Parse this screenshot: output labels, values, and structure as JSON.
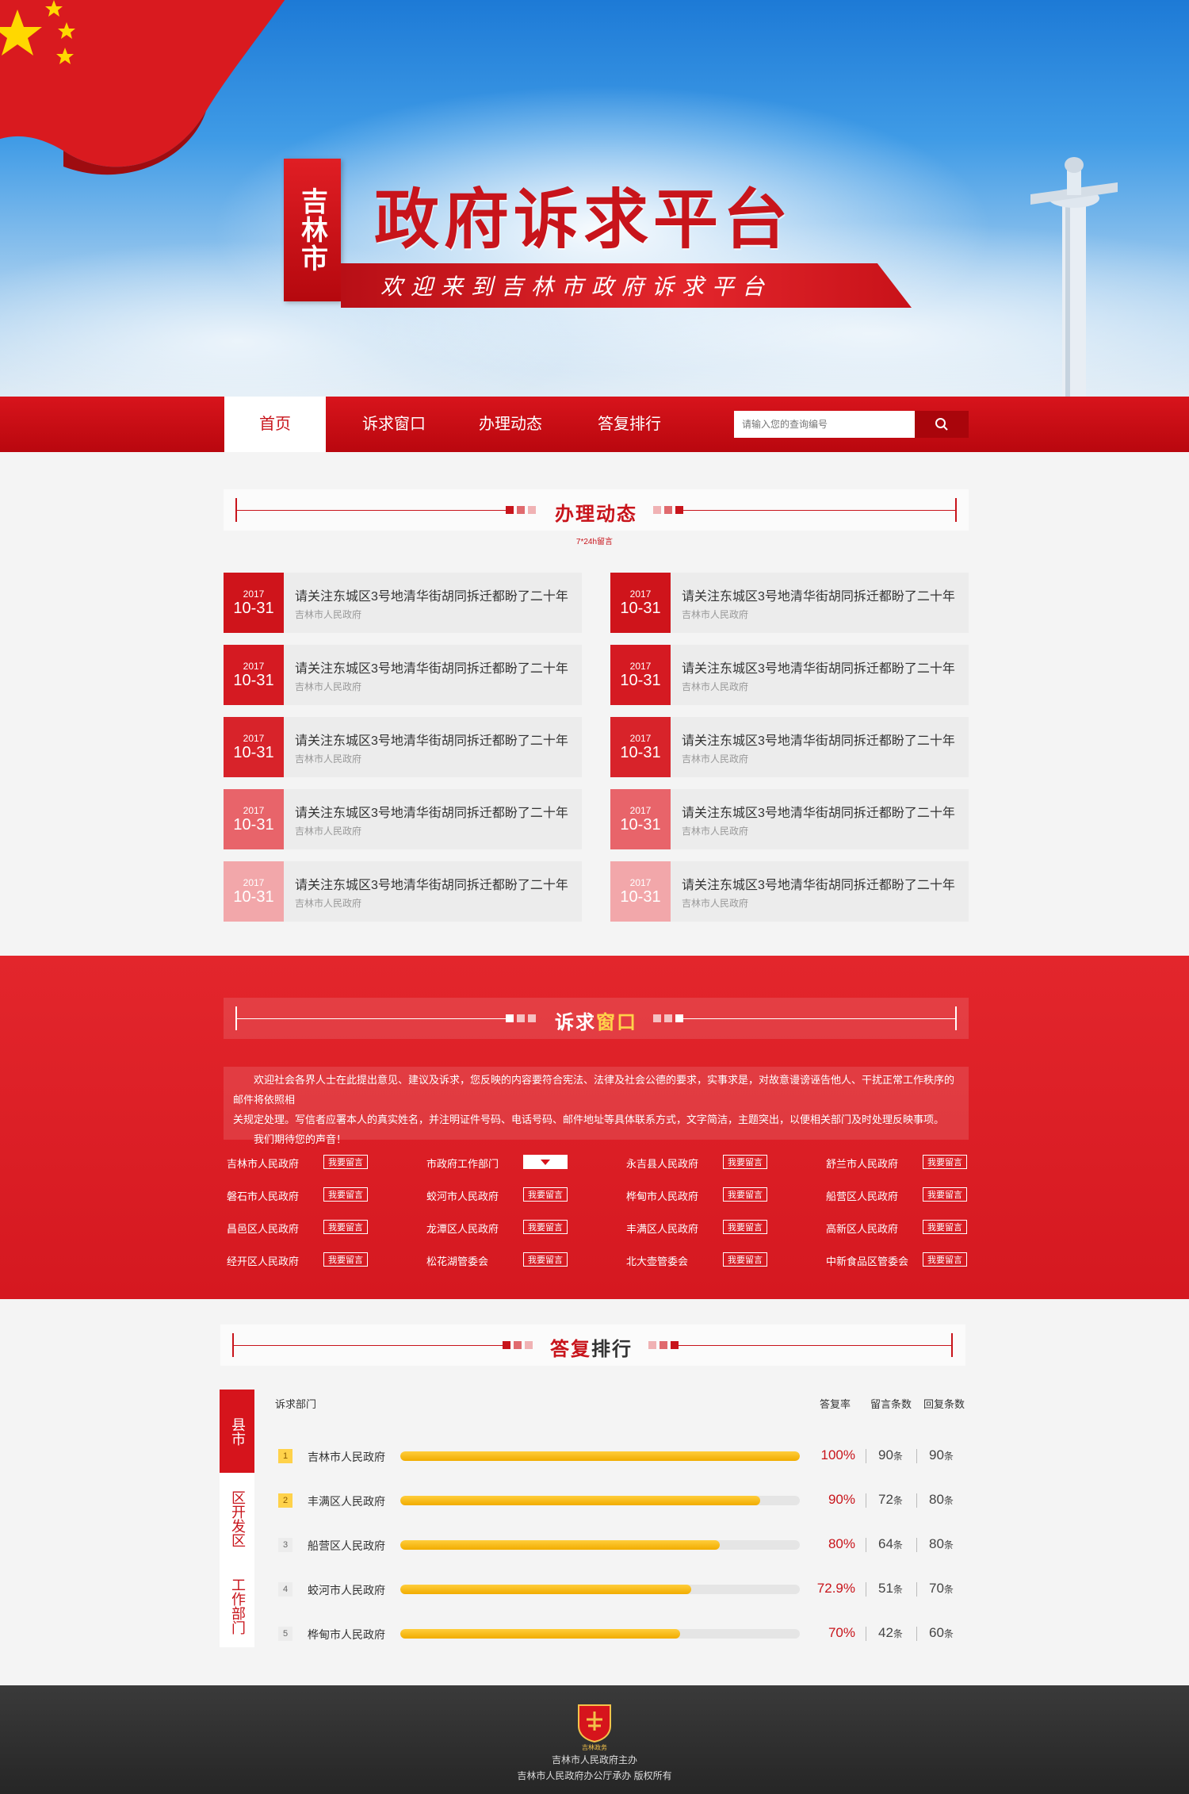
{
  "header": {
    "city": "吉林市",
    "title": "政府诉求平台",
    "welcome": "欢迎来到吉林市政府诉求平台"
  },
  "nav": {
    "items": [
      "首页",
      "诉求窗口",
      "办理动态",
      "答复排行"
    ],
    "active": "首页",
    "search_placeholder": "请输入您的查询编号"
  },
  "news_section": {
    "title": "办理动态",
    "subtitle": "7*24h留言",
    "items": [
      {
        "year": "2017",
        "date": "10-31",
        "title": "请关注东城区3号地清华街胡同拆迁都盼了二十年",
        "source": "吉林市人民政府"
      },
      {
        "year": "2017",
        "date": "10-31",
        "title": "请关注东城区3号地清华街胡同拆迁都盼了二十年",
        "source": "吉林市人民政府"
      },
      {
        "year": "2017",
        "date": "10-31",
        "title": "请关注东城区3号地清华街胡同拆迁都盼了二十年",
        "source": "吉林市人民政府"
      },
      {
        "year": "2017",
        "date": "10-31",
        "title": "请关注东城区3号地清华街胡同拆迁都盼了二十年",
        "source": "吉林市人民政府"
      },
      {
        "year": "2017",
        "date": "10-31",
        "title": "请关注东城区3号地清华街胡同拆迁都盼了二十年",
        "source": "吉林市人民政府"
      },
      {
        "year": "2017",
        "date": "10-31",
        "title": "请关注东城区3号地清华街胡同拆迁都盼了二十年",
        "source": "吉林市人民政府"
      },
      {
        "year": "2017",
        "date": "10-31",
        "title": "请关注东城区3号地清华街胡同拆迁都盼了二十年",
        "source": "吉林市人民政府"
      },
      {
        "year": "2017",
        "date": "10-31",
        "title": "请关注东城区3号地清华街胡同拆迁都盼了二十年",
        "source": "吉林市人民政府"
      },
      {
        "year": "2017",
        "date": "10-31",
        "title": "请关注东城区3号地清华街胡同拆迁都盼了二十年",
        "source": "吉林市人民政府"
      },
      {
        "year": "2017",
        "date": "10-31",
        "title": "请关注东城区3号地清华街胡同拆迁都盼了二十年",
        "source": "吉林市人民政府"
      }
    ]
  },
  "window_section": {
    "title_a": "诉求",
    "title_b": "窗口",
    "desc_line1": "欢迎社会各界人士在此提出意见、建议及诉求，您反映的内容要符合宪法、法律及社会公德的要求，实事求是，对故意谩谤诬告他人、干扰正常工作秩序的邮件将依照相",
    "desc_line2": "关规定处理。写信者应署本人的真实姓名，并注明证件号码、电话号码、邮件地址等具体联系方式，文字简洁，主题突出，以便相关部门及时处理反映事项。",
    "desc_line3": "我们期待您的声音！",
    "button_label": "我要留言",
    "departments": [
      "吉林市人民政府",
      "市政府工作部门",
      "永吉县人民政府",
      "舒兰市人民政府",
      "磐石市人民政府",
      "蛟河市人民政府",
      "桦甸市人民政府",
      "船营区人民政府",
      "昌邑区人民政府",
      "龙潭区人民政府",
      "丰满区人民政府",
      "高新区人民政府",
      "经开区人民政府",
      "松花湖管委会",
      "北大壶管委会",
      "中新食品区管委会"
    ]
  },
  "ranking_section": {
    "title_a": "答复",
    "title_b": "排行",
    "tabs": [
      "县市",
      "区开发区",
      "工作部门"
    ],
    "headers": {
      "dept": "诉求部门",
      "rate": "答复率",
      "messages": "留言条数",
      "replies": "回复条数"
    },
    "unit": "条",
    "rows": [
      {
        "rank": "1",
        "name": "吉林市人民政府",
        "rate_text": "100%",
        "rate": 1.0,
        "messages": "90",
        "replies": "90"
      },
      {
        "rank": "2",
        "name": "丰满区人民政府",
        "rate_text": "90%",
        "rate": 0.9,
        "messages": "72",
        "replies": "80"
      },
      {
        "rank": "3",
        "name": "船营区人民政府",
        "rate_text": "80%",
        "rate": 0.8,
        "messages": "64",
        "replies": "80"
      },
      {
        "rank": "4",
        "name": "蛟河市人民政府",
        "rate_text": "72.9%",
        "rate": 0.729,
        "messages": "51",
        "replies": "70"
      },
      {
        "rank": "5",
        "name": "桦甸市人民政府",
        "rate_text": "70%",
        "rate": 0.7,
        "messages": "42",
        "replies": "60"
      }
    ]
  },
  "footer": {
    "logo_text": "吉林政务",
    "line1": "吉林市人民政府主办",
    "line2": "吉林市人民政府办公厅承办 版权所有"
  },
  "colors": {
    "brand_red": "#d6141c",
    "bar_yellow": "#f3b400",
    "footer_dark": "#2b2b2b"
  }
}
